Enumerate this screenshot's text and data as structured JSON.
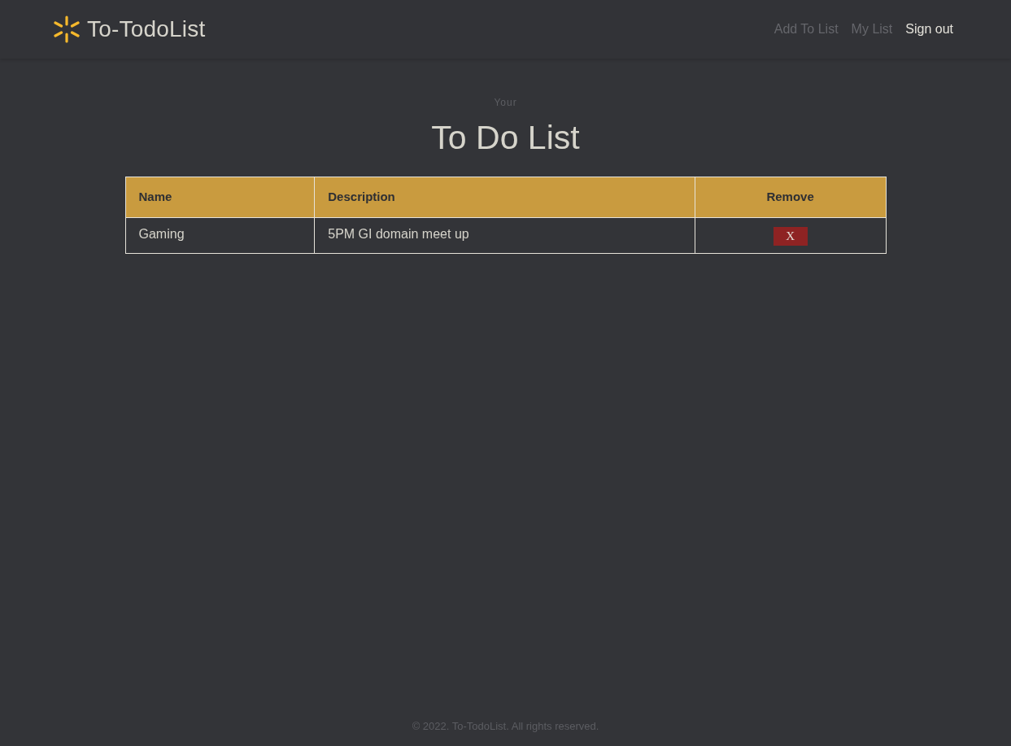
{
  "header": {
    "brand": "To-TodoList",
    "nav": [
      {
        "label": "Add To List",
        "kind": "link"
      },
      {
        "label": "My List",
        "kind": "link"
      },
      {
        "label": "Sign out",
        "kind": "action"
      }
    ]
  },
  "page": {
    "eyebrow": "Your",
    "title": "To Do List"
  },
  "table": {
    "columns": [
      "Name",
      "Description",
      "Remove"
    ],
    "rows": [
      {
        "name": "Gaming",
        "description": "5PM GI domain meet up",
        "remove": "X"
      }
    ]
  },
  "footer": {
    "text": "© 2022. To-TodoList. All rights reserved."
  }
}
